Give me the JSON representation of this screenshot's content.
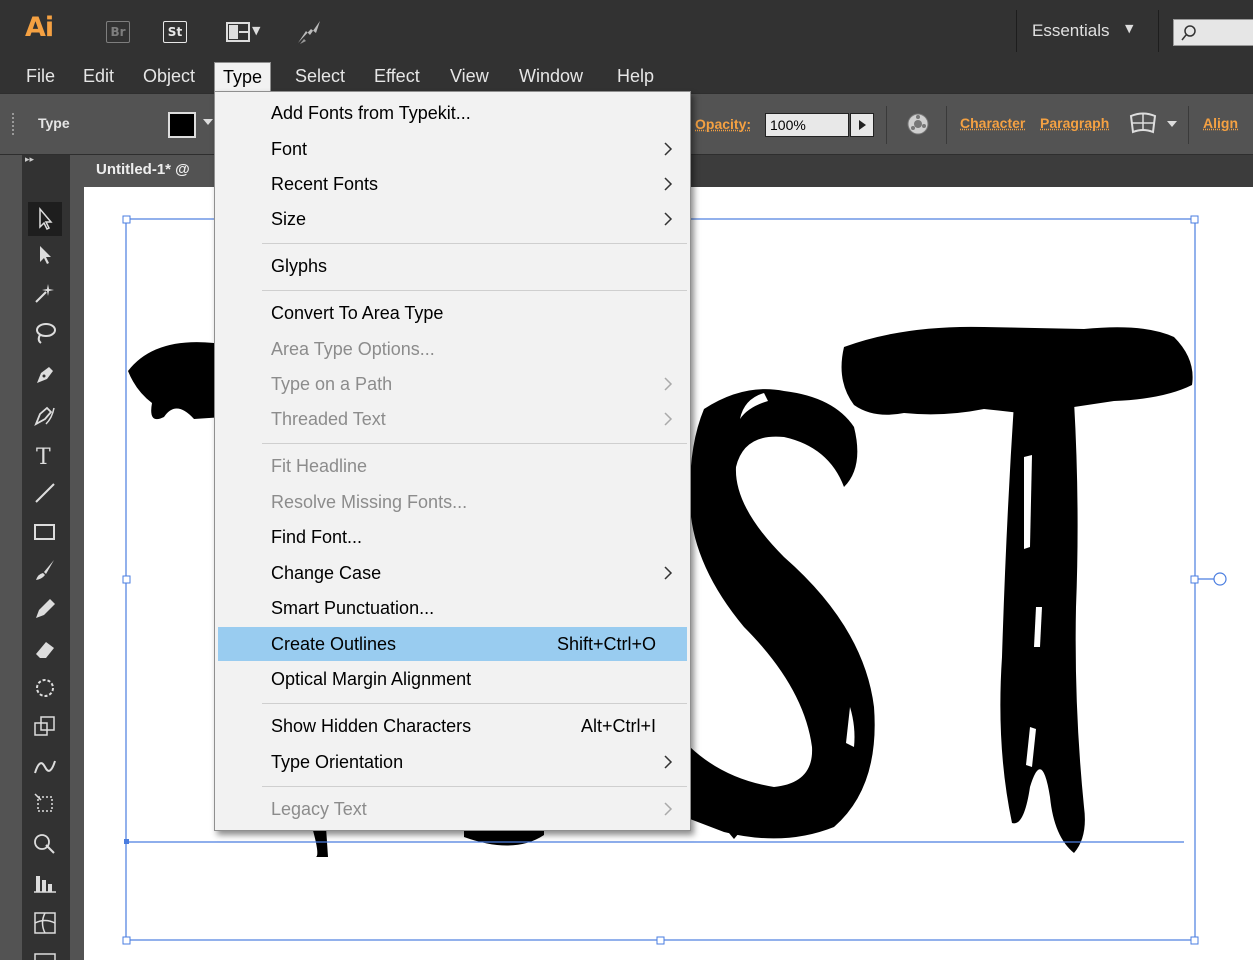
{
  "app": {
    "logo": "Ai",
    "bridge_button": "Br",
    "stock_button": "St",
    "workspace": "Essentials"
  },
  "menubar": {
    "items": [
      "File",
      "Edit",
      "Object",
      "Type",
      "Select",
      "Effect",
      "View",
      "Window",
      "Help"
    ],
    "active": "Type"
  },
  "controlbar": {
    "tool_label": "Type",
    "fill_color": "#000000",
    "opacity_label": "Opacity:",
    "opacity_value": "100%",
    "character_link": "Character",
    "paragraph_link": "Paragraph",
    "align_link": "Align"
  },
  "document": {
    "tab_label": "Untitled-1* @"
  },
  "type_menu": {
    "items": [
      {
        "label": "Add Fonts from Typekit...",
        "enabled": true
      },
      {
        "label": "Font",
        "enabled": true,
        "submenu": true
      },
      {
        "label": "Recent Fonts",
        "enabled": true,
        "submenu": true
      },
      {
        "label": "Size",
        "enabled": true,
        "submenu": true
      },
      {
        "label": "Glyphs",
        "enabled": true
      },
      {
        "label": "Convert To Area Type",
        "enabled": true
      },
      {
        "label": "Area Type Options...",
        "enabled": false
      },
      {
        "label": "Type on a Path",
        "enabled": false,
        "submenu": true
      },
      {
        "label": "Threaded Text",
        "enabled": false,
        "submenu": true
      },
      {
        "label": "Fit Headline",
        "enabled": false
      },
      {
        "label": "Resolve Missing Fonts...",
        "enabled": false
      },
      {
        "label": "Find Font...",
        "enabled": true
      },
      {
        "label": "Change Case",
        "enabled": true,
        "submenu": true
      },
      {
        "label": "Smart Punctuation...",
        "enabled": true
      },
      {
        "label": "Create Outlines",
        "enabled": true,
        "shortcut": "Shift+Ctrl+O",
        "highlighted": true
      },
      {
        "label": "Optical Margin Alignment",
        "enabled": true
      },
      {
        "label": "Show Hidden Characters",
        "enabled": true,
        "shortcut": "Alt+Ctrl+I"
      },
      {
        "label": "Type Orientation",
        "enabled": true,
        "submenu": true
      },
      {
        "label": "Legacy Text",
        "enabled": false,
        "submenu": true
      }
    ]
  },
  "colors": {
    "accent": "#f5a142",
    "highlight": "#99ccf0",
    "selection": "#4a7de0"
  }
}
